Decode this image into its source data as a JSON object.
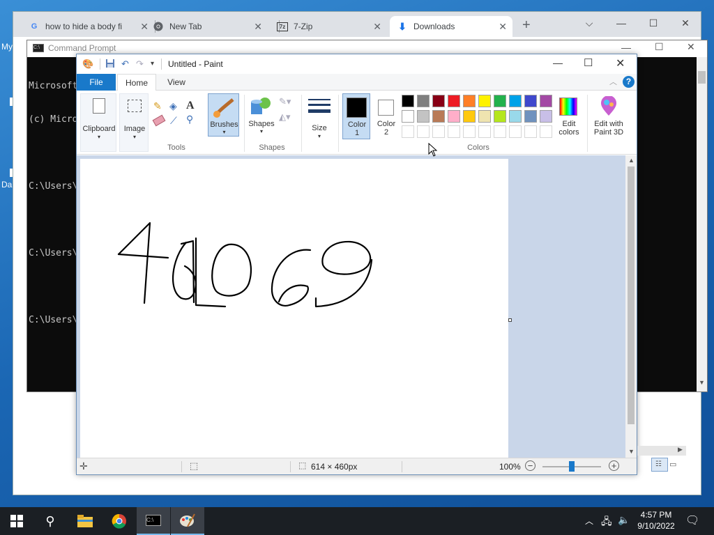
{
  "desktop": {
    "frag1": "My",
    "frag2": "Da"
  },
  "chrome": {
    "tabs": [
      {
        "label": "how to hide a body fi",
        "icon": "google-icon"
      },
      {
        "label": "New Tab",
        "icon": "chrome-icon"
      },
      {
        "label": "7-Zip",
        "icon": "7zip-icon"
      },
      {
        "label": "Downloads",
        "icon": "download-icon"
      }
    ],
    "new_tab": "+"
  },
  "cmd": {
    "title": "Command Prompt",
    "lines": [
      "Microsoft",
      "(c) Micro",
      "",
      "C:\\Users\\",
      "",
      "C:\\Users\\",
      "",
      "C:\\Users\\"
    ]
  },
  "paint": {
    "title": "Untitled - Paint",
    "tabs": {
      "file": "File",
      "home": "Home",
      "view": "View"
    },
    "groups": {
      "clipboard": "Clipboard",
      "image": "Image",
      "tools": "Tools",
      "brushes": "Brushes",
      "shapes_btn": "Shapes",
      "shapes": "Shapes",
      "size": "Size",
      "color1": "Color\n1",
      "color2": "Color\n2",
      "colors": "Colors",
      "edit_colors": "Edit\ncolors",
      "edit_3d": "Edit with\nPaint 3D"
    },
    "palette_row1": [
      "#000000",
      "#7f7f7f",
      "#880015",
      "#ed1c24",
      "#ff7f27",
      "#fff200",
      "#22b14c",
      "#00a2e8",
      "#3f48cc",
      "#a349a4"
    ],
    "palette_row2": [
      "#ffffff",
      "#c3c3c3",
      "#b97a57",
      "#ffaec9",
      "#ffc90e",
      "#efe4b0",
      "#b5e61d",
      "#99d9ea",
      "#7092be",
      "#c8bfe7"
    ],
    "status": {
      "size": "614 × 460px",
      "zoom": "100%"
    },
    "zoom_level": 100
  },
  "taskbar": {
    "time": "4:57 PM",
    "date": "9/10/2022"
  }
}
